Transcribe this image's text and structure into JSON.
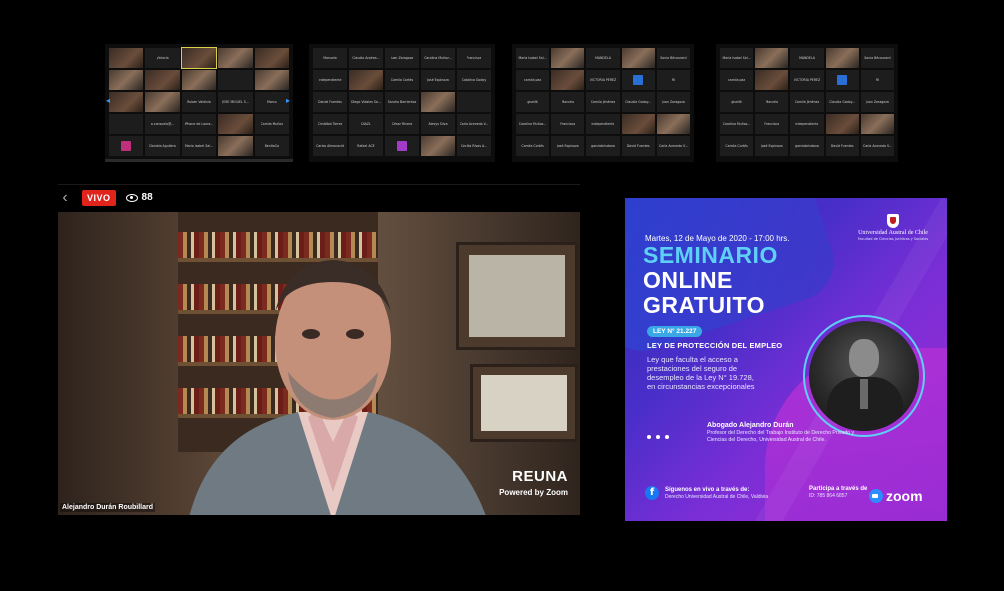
{
  "thumbnails": [
    {
      "cols": 5,
      "tiles": [
        {
          "label": "",
          "video": true
        },
        {
          "label": "Victoria",
          "video": false
        },
        {
          "label": "",
          "video": true,
          "highlight": true
        },
        {
          "label": "",
          "video": true
        },
        {
          "label": "",
          "video": true
        },
        {
          "label": "",
          "video": true
        },
        {
          "label": "",
          "video": true
        },
        {
          "label": "",
          "video": true
        },
        {
          "label": "",
          "video": false
        },
        {
          "label": "",
          "video": true
        },
        {
          "label": "",
          "video": true
        },
        {
          "label": "",
          "video": true
        },
        {
          "label": "Ruben Valdivia",
          "video": false
        },
        {
          "label": "JOSE MIGUEL S...",
          "video": false
        },
        {
          "label": "Marco",
          "video": false
        },
        {
          "label": "",
          "video": false
        },
        {
          "label": "a.consuelo@...",
          "video": false
        },
        {
          "label": "iPhone de Laura...",
          "video": false
        },
        {
          "label": "",
          "video": true
        },
        {
          "label": "Camila Muñoz",
          "video": false
        },
        {
          "label": "",
          "video": false,
          "avatar": "#c0307a"
        },
        {
          "label": "Daniela Aguilera",
          "video": false
        },
        {
          "label": "Mario Isabel Sal...",
          "video": false
        },
        {
          "label": "",
          "video": true
        },
        {
          "label": "BenitaCa",
          "video": false
        }
      ]
    },
    {
      "cols": 5,
      "tiles": [
        {
          "label": "Manuela"
        },
        {
          "label": "Claudia Andrea..."
        },
        {
          "label": "Juan Zaragoza"
        },
        {
          "label": "Carolina Muñoz..."
        },
        {
          "label": "Francisca"
        },
        {
          "label": "independiente"
        },
        {
          "label": "",
          "video": true
        },
        {
          "label": "Camila Cortés"
        },
        {
          "label": "José Espinoza"
        },
        {
          "label": "Catalina Godoy"
        },
        {
          "label": "Daniel Fuentes"
        },
        {
          "label": "Diego Vidales Sa..."
        },
        {
          "label": "Sandra Barrientos"
        },
        {
          "label": "",
          "video": true
        },
        {
          "label": ""
        },
        {
          "label": "Cristóbal Torres"
        },
        {
          "label": "DIAZL"
        },
        {
          "label": "César Rivera"
        },
        {
          "label": "Alexys Silva"
        },
        {
          "label": "Carla Acevedo V..."
        },
        {
          "label": "Carlos Almonacid"
        },
        {
          "label": "Rafael ACE"
        },
        {
          "label": "",
          "avatar": "#a23bc8"
        },
        {
          "label": "",
          "video": true
        },
        {
          "label": "Cecilia Rivas A..."
        }
      ]
    },
    {
      "cols": 5,
      "tiles": [
        {
          "label": "Maria Isabel Sal..."
        },
        {
          "label": "",
          "video": true
        },
        {
          "label": "MANDELA"
        },
        {
          "label": "",
          "video": true
        },
        {
          "label": "Sonia Bécourard"
        },
        {
          "label": "camila paz"
        },
        {
          "label": "",
          "video": true
        },
        {
          "label": "VICTORIA PEREZ"
        },
        {
          "label": "",
          "avatar": "#2a6fd6"
        },
        {
          "label": "RI"
        },
        {
          "label": "gisellit"
        },
        {
          "label": "Marcelo"
        },
        {
          "label": "Camila Jiménez"
        },
        {
          "label": "Claudia Godoy..."
        },
        {
          "label": "Juan Zaragoza"
        },
        {
          "label": "Carolina Muñoz..."
        },
        {
          "label": "Francisca"
        },
        {
          "label": "independiente"
        },
        {
          "label": "",
          "video": true
        },
        {
          "label": "",
          "video": true
        },
        {
          "label": "Camila Cortés"
        },
        {
          "label": "José Espinoza"
        },
        {
          "label": "garciabrisdana"
        },
        {
          "label": "David Fuentes"
        },
        {
          "label": "Carla Acevedo V..."
        }
      ]
    },
    {
      "cols": 5,
      "tiles": [
        {
          "label": "Maria Isabel Sal..."
        },
        {
          "label": "",
          "video": true
        },
        {
          "label": "MANDELA"
        },
        {
          "label": "",
          "video": true
        },
        {
          "label": "Sonia Bécourard"
        },
        {
          "label": "camila paz"
        },
        {
          "label": "",
          "video": true
        },
        {
          "label": "VICTORIA PEREZ"
        },
        {
          "label": "",
          "avatar": "#2a6fd6"
        },
        {
          "label": "RI"
        },
        {
          "label": "gisellit"
        },
        {
          "label": "Marcelo"
        },
        {
          "label": "Camila Jiménez"
        },
        {
          "label": "Claudia Godoy..."
        },
        {
          "label": "Juan Zaragoza"
        },
        {
          "label": "Carolina Muñoz..."
        },
        {
          "label": "Francisca"
        },
        {
          "label": "independiente"
        },
        {
          "label": "",
          "video": true
        },
        {
          "label": "",
          "video": true
        },
        {
          "label": "Camila Cortés"
        },
        {
          "label": "José Espinoza"
        },
        {
          "label": "garciabrisdana"
        },
        {
          "label": "David Fuentes"
        },
        {
          "label": "Carla Acevedo V..."
        }
      ]
    }
  ],
  "live": {
    "badge": "VIVO",
    "viewers": "88"
  },
  "video": {
    "watermark": "REUNA",
    "powered_by": "Powered by Zoom",
    "speaker": "Alejandro Durán Roubillard"
  },
  "poster": {
    "university": "Universidad Austral de Chile",
    "faculty": "Facultad de Ciencias Jurídicas y Sociales",
    "date": "Martes, 12 de Mayo de 2020 - 17:00 hrs.",
    "title_line1": "SEMINARIO",
    "title_line2": "ONLINE",
    "title_line3": "GRATUITO",
    "law_pill": "LEY N° 21.227",
    "law_title": "LEY DE PROTECCIÓN DEL EMPLEO",
    "description": "Ley que faculta el acceso a prestaciones del seguro de desempleo de la Ley N° 19.728, en circunstancias excepcionales",
    "lawyer_name": "Abogado Alejandro Durán",
    "lawyer_role": "Profesor del Derecho del Trabajo Instituto de Derecho Privado y Ciencias del Derecho, Universidad Austral de Chile.",
    "follow_heading": "Síguenos en vivo a través de:",
    "follow_text": "Derecho Universidad Austral de Chile, Valdivia",
    "zoom_heading": "Participa a través de",
    "zoom_id": "ID: 785 864 6857",
    "zoom_logo": "zoom",
    "fb_glyph": "f"
  }
}
